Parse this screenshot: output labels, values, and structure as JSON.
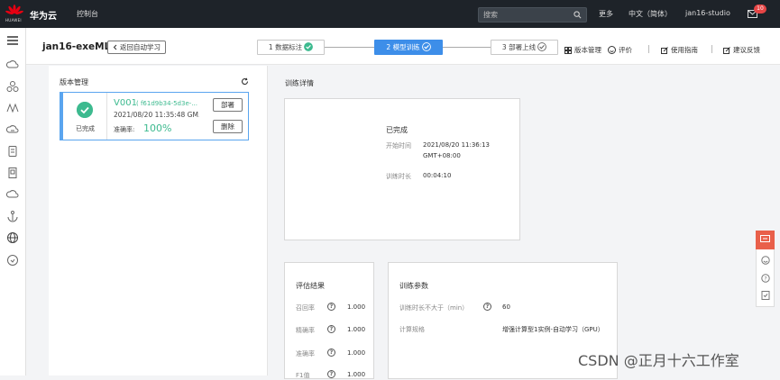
{
  "topbar": {
    "brand": "华为云",
    "logo_text": "HUAWEI",
    "console": "控制台",
    "search_placeholder": "搜索",
    "more": "更多",
    "language": "中文（简体）",
    "user": "jan16-studio",
    "mail_count": "10"
  },
  "page": {
    "title": "jan16-exeML",
    "back": "返回自动学习"
  },
  "steps": [
    {
      "label": "1 数据标注"
    },
    {
      "label": "2 模型训练"
    },
    {
      "label": "3 部署上线"
    }
  ],
  "tools": {
    "version_mgmt": "版本管理",
    "rate": "评价",
    "guide": "使用指南",
    "feedback": "建议反馈"
  },
  "versions": {
    "title": "版本管理",
    "card": {
      "status": "已完成",
      "name": "V001",
      "hash": "( f61d9b34-5d3e-...",
      "time": "2021/08/20 11:35:48 GM...",
      "accuracy_label": "准确率:",
      "accuracy": "100%",
      "deploy": "部署",
      "delete": "删除"
    }
  },
  "detail": {
    "title": "训练详情",
    "status": "已完成",
    "start_label": "开始时间",
    "start_value_1": "2021/08/20 11:36:13",
    "start_value_2": "GMT+08:00",
    "duration_label": "训练时长",
    "duration_value": "00:04:10"
  },
  "eval": {
    "title": "评估结果",
    "rows": [
      {
        "label": "召回率",
        "value": "1.000"
      },
      {
        "label": "精确率",
        "value": "1.000"
      },
      {
        "label": "准确率",
        "value": "1.000"
      },
      {
        "label": "F1值",
        "value": "1.000"
      }
    ]
  },
  "params": {
    "title": "训练参数",
    "duration_label": "训练时长不大于（min）",
    "duration_value": "60",
    "spec_label": "计算规格",
    "spec_value": "增强计算型1实例-自动学习（GPU）"
  },
  "watermark": "CSDN @正月十六工作室",
  "colors": {
    "accent": "#3d8ee9",
    "success": "#3dba8f",
    "topbar": "#1e2329",
    "float": "#e9604a"
  }
}
